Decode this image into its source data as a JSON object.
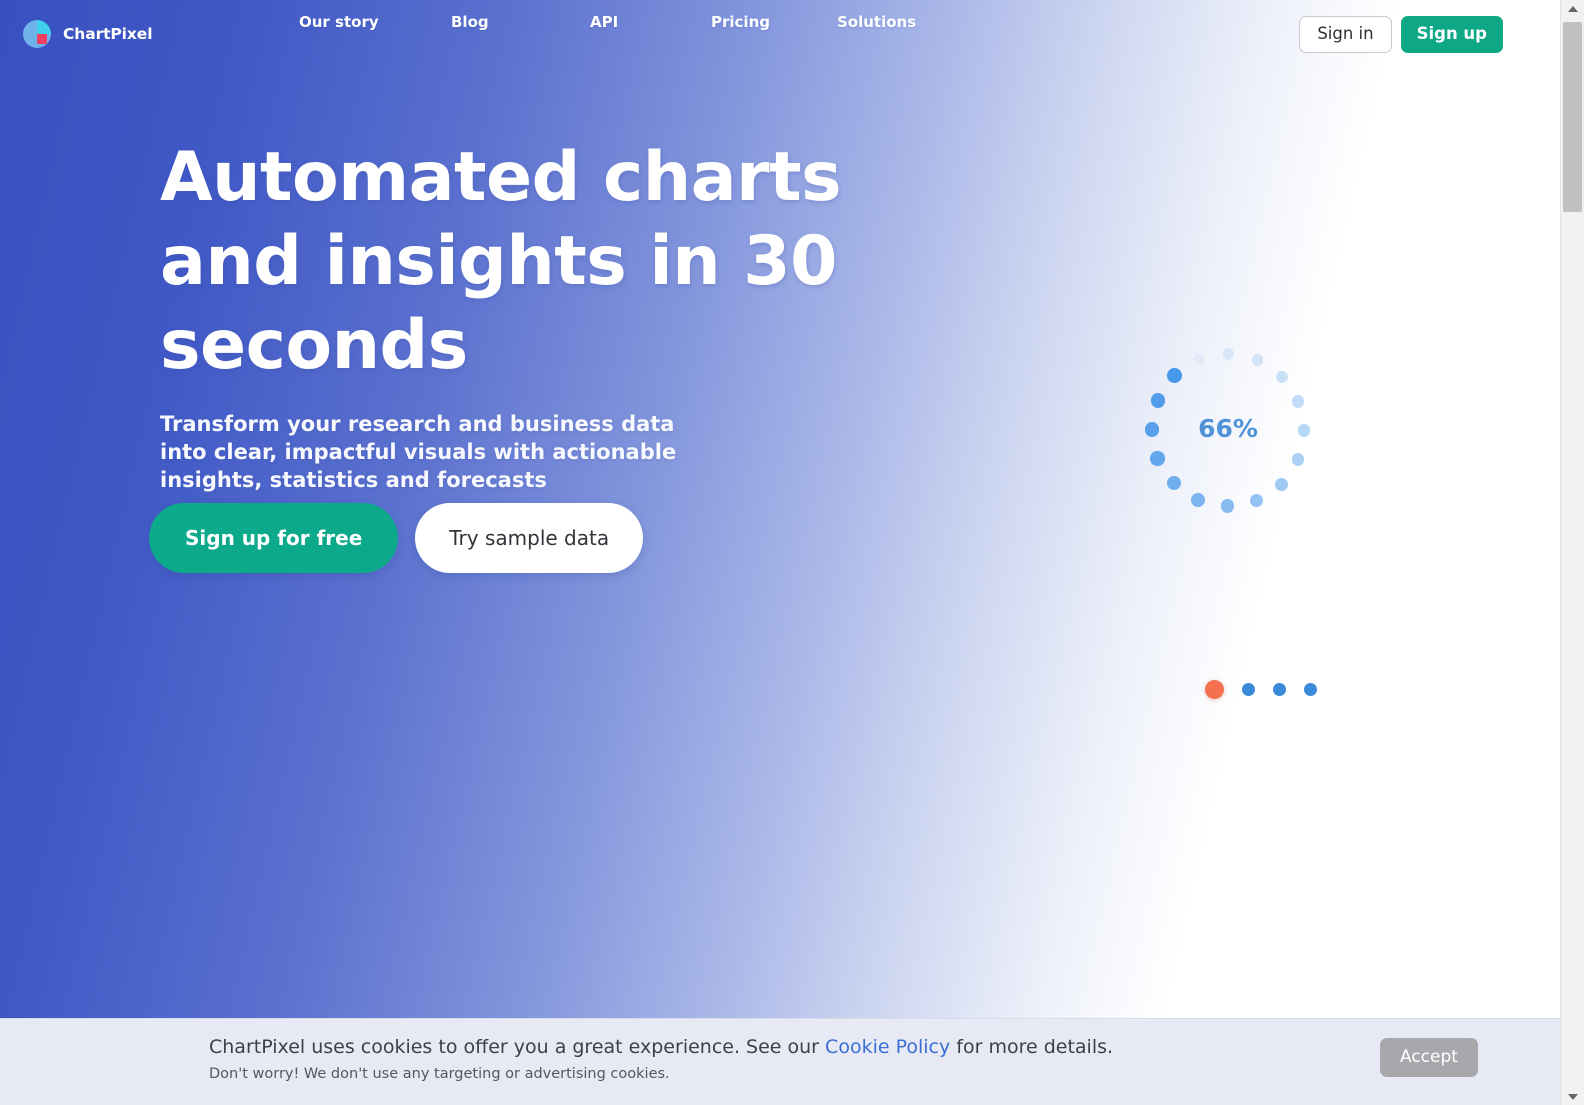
{
  "brand": {
    "name": "ChartPixel",
    "logo_icon": "pie-chart-logo-icon"
  },
  "nav": {
    "links": [
      {
        "label": "Our story"
      },
      {
        "label": "Blog"
      },
      {
        "label": "API"
      },
      {
        "label": "Pricing"
      },
      {
        "label": "Solutions"
      }
    ],
    "signin_label": "Sign in",
    "signup_label": "Sign up"
  },
  "hero": {
    "title": "Automated charts and insights in 30 seconds",
    "subtitle": "Transform your research and business data into clear, impactful visuals with actionable insights, statistics and forecasts",
    "primary_cta": "Sign up for free",
    "secondary_cta": "Try sample data"
  },
  "spinner": {
    "percent_label": "66%",
    "percent_value": 66,
    "dot_count": 16,
    "dot_color": "#3d92e8",
    "text_color": "#4f92d8"
  },
  "carousel": {
    "total": 4,
    "active_index": 0,
    "active_color": "#f4704f",
    "inactive_color": "#3b8ada"
  },
  "cookie_banner": {
    "text_before_link": "ChartPixel uses cookies to offer you a great experience. See our ",
    "link_label": "Cookie Policy",
    "text_after_link": " for more details.",
    "sub_text": "Don't worry! We don't use any targeting or advertising cookies.",
    "accept_label": "Accept"
  },
  "theme": {
    "brand_blue": "#3950c0",
    "accent_teal": "#0ca98a",
    "link_blue": "#3b6fd4"
  }
}
